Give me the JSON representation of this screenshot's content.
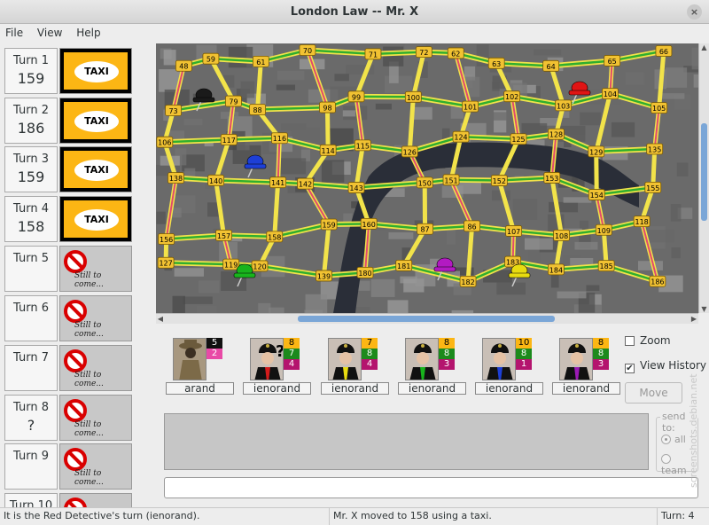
{
  "window": {
    "title": "London Law -- Mr. X",
    "close_icon": "×"
  },
  "menu": [
    "File",
    "View",
    "Help"
  ],
  "turns": [
    {
      "label": "Turn 1",
      "pos": "159",
      "ticket": "TAXI"
    },
    {
      "label": "Turn 2",
      "pos": "186",
      "ticket": "TAXI"
    },
    {
      "label": "Turn 3",
      "pos": "159",
      "ticket": "TAXI"
    },
    {
      "label": "Turn 4",
      "pos": "158",
      "ticket": "TAXI"
    },
    {
      "label": "Turn 5",
      "pos": "",
      "ticket": "Still to come..."
    },
    {
      "label": "Turn 6",
      "pos": "",
      "ticket": "Still to come..."
    },
    {
      "label": "Turn 7",
      "pos": "",
      "ticket": "Still to come..."
    },
    {
      "label": "Turn 8",
      "pos": "?",
      "ticket": "Still to come..."
    },
    {
      "label": "Turn 9",
      "pos": "",
      "ticket": "Still to come..."
    },
    {
      "label": "Turn 10",
      "pos": "",
      "ticket": ""
    }
  ],
  "map": {
    "stations": [
      "48",
      "59",
      "61",
      "70",
      "71",
      "72",
      "62",
      "63",
      "64",
      "65",
      "66",
      "73",
      "79",
      "88",
      "98",
      "99",
      "100",
      "101",
      "102",
      "103",
      "104",
      "105",
      "106",
      "117",
      "116",
      "114",
      "115",
      "126",
      "124",
      "125",
      "128",
      "129",
      "135",
      "138",
      "140",
      "141",
      "142",
      "143",
      "150",
      "151",
      "152",
      "153",
      "154",
      "155",
      "156",
      "157",
      "158",
      "159",
      "160",
      "87",
      "86",
      "107",
      "108",
      "109",
      "118",
      "127",
      "119",
      "120",
      "139",
      "180",
      "181",
      "182",
      "183",
      "184",
      "185",
      "186"
    ],
    "pieces": [
      {
        "name": "black-pin",
        "color": "#1a1a1a"
      },
      {
        "name": "blue-pin",
        "color": "#1d3fd6"
      },
      {
        "name": "green-pin",
        "color": "#18b41c"
      },
      {
        "name": "magenta-pin",
        "color": "#b21ac2"
      },
      {
        "name": "yellow-pin",
        "color": "#e8dc10"
      },
      {
        "name": "red-pin",
        "color": "#e01414"
      }
    ]
  },
  "players": [
    {
      "name": "arand",
      "color": "#c2b79b",
      "mrx": true,
      "tickets": [
        "5",
        "2"
      ]
    },
    {
      "name": "ienorand",
      "color": "#d41b1b",
      "unknown": "?",
      "tickets": [
        "8",
        "7",
        "4"
      ]
    },
    {
      "name": "ienorand",
      "color": "#e8dc10",
      "tickets": [
        "7",
        "8",
        "4"
      ]
    },
    {
      "name": "ienorand",
      "color": "#18b41c",
      "tickets": [
        "8",
        "8",
        "3"
      ]
    },
    {
      "name": "ienorand",
      "color": "#1d3fd6",
      "tickets": [
        "10",
        "8",
        "1"
      ]
    },
    {
      "name": "ienorand",
      "color": "#9a1ab4",
      "tickets": [
        "8",
        "8",
        "3"
      ]
    }
  ],
  "controls": {
    "zoom": "Zoom",
    "zoom_checked": false,
    "view_history": "View History",
    "view_history_checked": true,
    "move": "Move",
    "send_to": "send to:",
    "send_all": "all",
    "send_team": "team"
  },
  "status": {
    "left": "It is the Red Detective's turn (ienorand).",
    "middle": "Mr. X moved to 158 using a taxi.",
    "right": "Turn: 4"
  },
  "watermark": "screenshots.debian.net",
  "colors": {
    "taxi": "#fcb614",
    "bus": "#1c8a1c",
    "underground": "#b4146e",
    "mrx_ticket": "#111111",
    "double": "#e84aa6"
  }
}
